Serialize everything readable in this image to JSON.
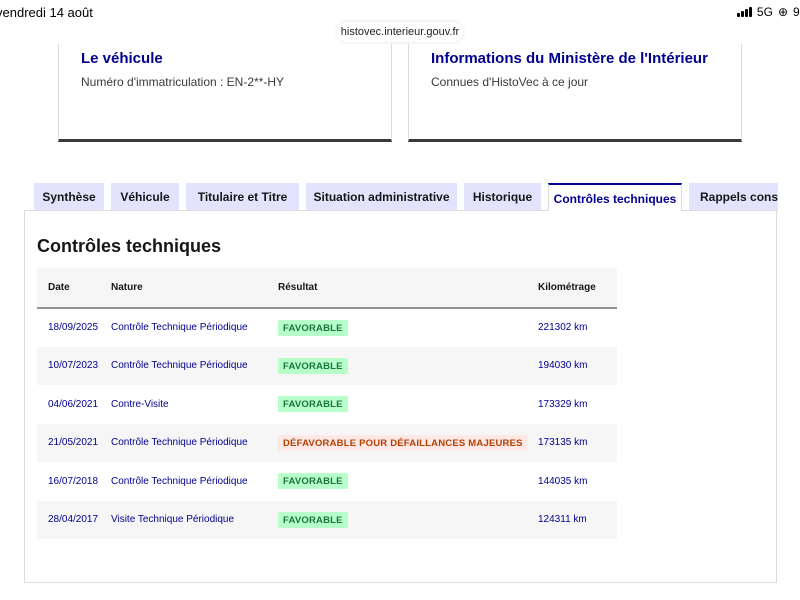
{
  "status_bar": {
    "time": "vendredi 14 août",
    "network": "5G",
    "battery": "9"
  },
  "browser": {
    "url": "histovec.interieur.gouv.fr"
  },
  "cards": {
    "vehicle": {
      "title": "Le véhicule",
      "subtitle": "Numéro d'immatriculation : EN-2**-HY"
    },
    "ministry": {
      "title": "Informations du Ministère de l'Intérieur",
      "subtitle": "Connues d'HistoVec à ce jour"
    }
  },
  "tabs": [
    {
      "label": "Synthèse",
      "active": false
    },
    {
      "label": "Véhicule",
      "active": false
    },
    {
      "label": "Titulaire et Titre",
      "active": false
    },
    {
      "label": "Situation administrative",
      "active": false
    },
    {
      "label": "Historique",
      "active": false
    },
    {
      "label": "Contrôles techniques",
      "active": true
    },
    {
      "label": "Rappels constructeur",
      "active": false
    }
  ],
  "section": {
    "title": "Contrôles techniques",
    "table": {
      "headers": [
        "Date",
        "Nature",
        "Résultat",
        "Kilométrage"
      ],
      "rows": [
        {
          "date": "18/09/2025",
          "nature": "Contrôle Technique Périodique",
          "result": "FAVORABLE",
          "status": "favorable",
          "km": "221302 km"
        },
        {
          "date": "10/07/2023",
          "nature": "Contrôle Technique Périodique",
          "result": "FAVORABLE",
          "status": "favorable",
          "km": "194030 km"
        },
        {
          "date": "04/06/2021",
          "nature": "Contre-Visite",
          "result": "FAVORABLE",
          "status": "favorable",
          "km": "173329 km"
        },
        {
          "date": "21/05/2021",
          "nature": "Contrôle Technique Périodique",
          "result": "DÉFAVORABLE POUR DÉFAILLANCES MAJEURES",
          "status": "defavorable",
          "km": "173135 km"
        },
        {
          "date": "16/07/2018",
          "nature": "Contrôle Technique Périodique",
          "result": "FAVORABLE",
          "status": "favorable",
          "km": "144035 km"
        },
        {
          "date": "28/04/2017",
          "nature": "Visite Technique Périodique",
          "result": "FAVORABLE",
          "status": "favorable",
          "km": "124311 km"
        }
      ]
    }
  },
  "colors": {
    "brand_blue": "#000091",
    "tab_bg": "#e3e3fd",
    "favorable_bg": "#b8fec9",
    "favorable_text": "#18753c",
    "defavorable_bg": "#ffe9e6",
    "defavorable_text": "#b34000"
  }
}
